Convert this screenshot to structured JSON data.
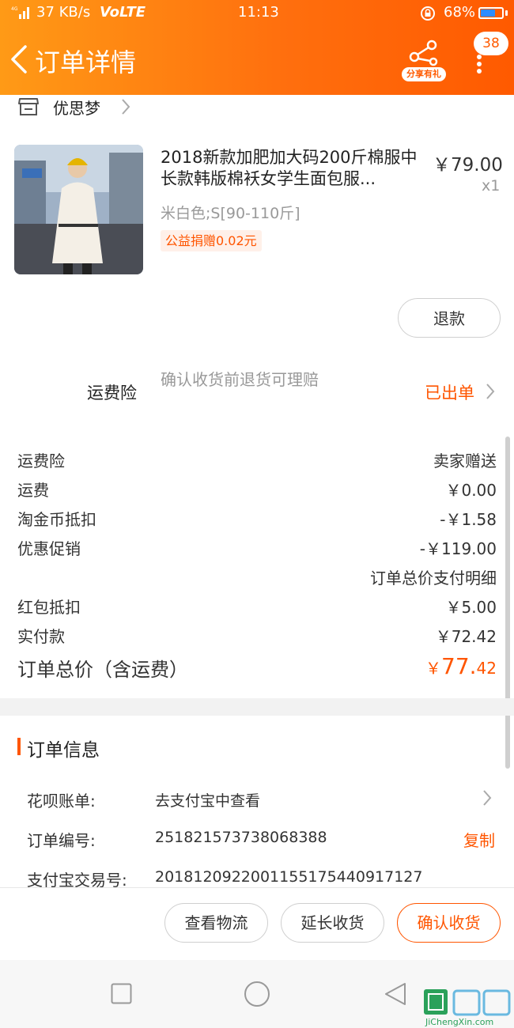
{
  "status_bar": {
    "network_speed": "37 KB/s",
    "volte": "VoLTE",
    "time": "11:13",
    "battery": "68%",
    "battery_level": 0.68
  },
  "header": {
    "back_label": "订单详情",
    "share_label": "分享有礼",
    "badge_count": "38"
  },
  "shop": {
    "name": "优思梦"
  },
  "product": {
    "title": "2018新款加肥加大码200斤棉服中长款韩版棉袄女学生面包服...",
    "price": "￥79.00",
    "quantity": "x1",
    "sku": "米白色;S[90-110斤]",
    "charity": "公益捐赠0.02元",
    "refund_button": "退款"
  },
  "insurance": {
    "label": "运费险",
    "description": "确认收货前退货可理赔",
    "status": "已出单"
  },
  "summary": {
    "rows": [
      {
        "label": "运费险",
        "value": "卖家赠送"
      },
      {
        "label": "运费",
        "value": "￥0.00"
      },
      {
        "label": "淘金币抵扣",
        "value": "-￥1.58"
      },
      {
        "label": "优惠促销",
        "value": "-￥119.00"
      },
      {
        "label": "",
        "value": "订单总价支付明细"
      },
      {
        "label": "红包抵扣",
        "value": "￥5.00"
      },
      {
        "label": "实付款",
        "value": "￥72.42"
      }
    ],
    "total_label": "订单总价（含运费）",
    "total_currency": "￥",
    "total_integer": "77.",
    "total_decimal": "42"
  },
  "order_info": {
    "section_title": "订单信息",
    "rows": [
      {
        "label": "花呗账单:",
        "value": "去支付宝中查看"
      },
      {
        "label": "订单编号:",
        "value": "251821573738068388"
      },
      {
        "label": "支付宝交易号:",
        "value": "2018120922001155175440917127"
      }
    ],
    "copy_label": "复制"
  },
  "actions": {
    "logistics": "查看物流",
    "extend": "延长收货",
    "confirm": "确认收货"
  },
  "watermark": {
    "text": "JiChengXin.com"
  },
  "colors": {
    "accent": "#ff5500",
    "header_start": "#ff9a16",
    "header_end": "#ff5a00"
  }
}
